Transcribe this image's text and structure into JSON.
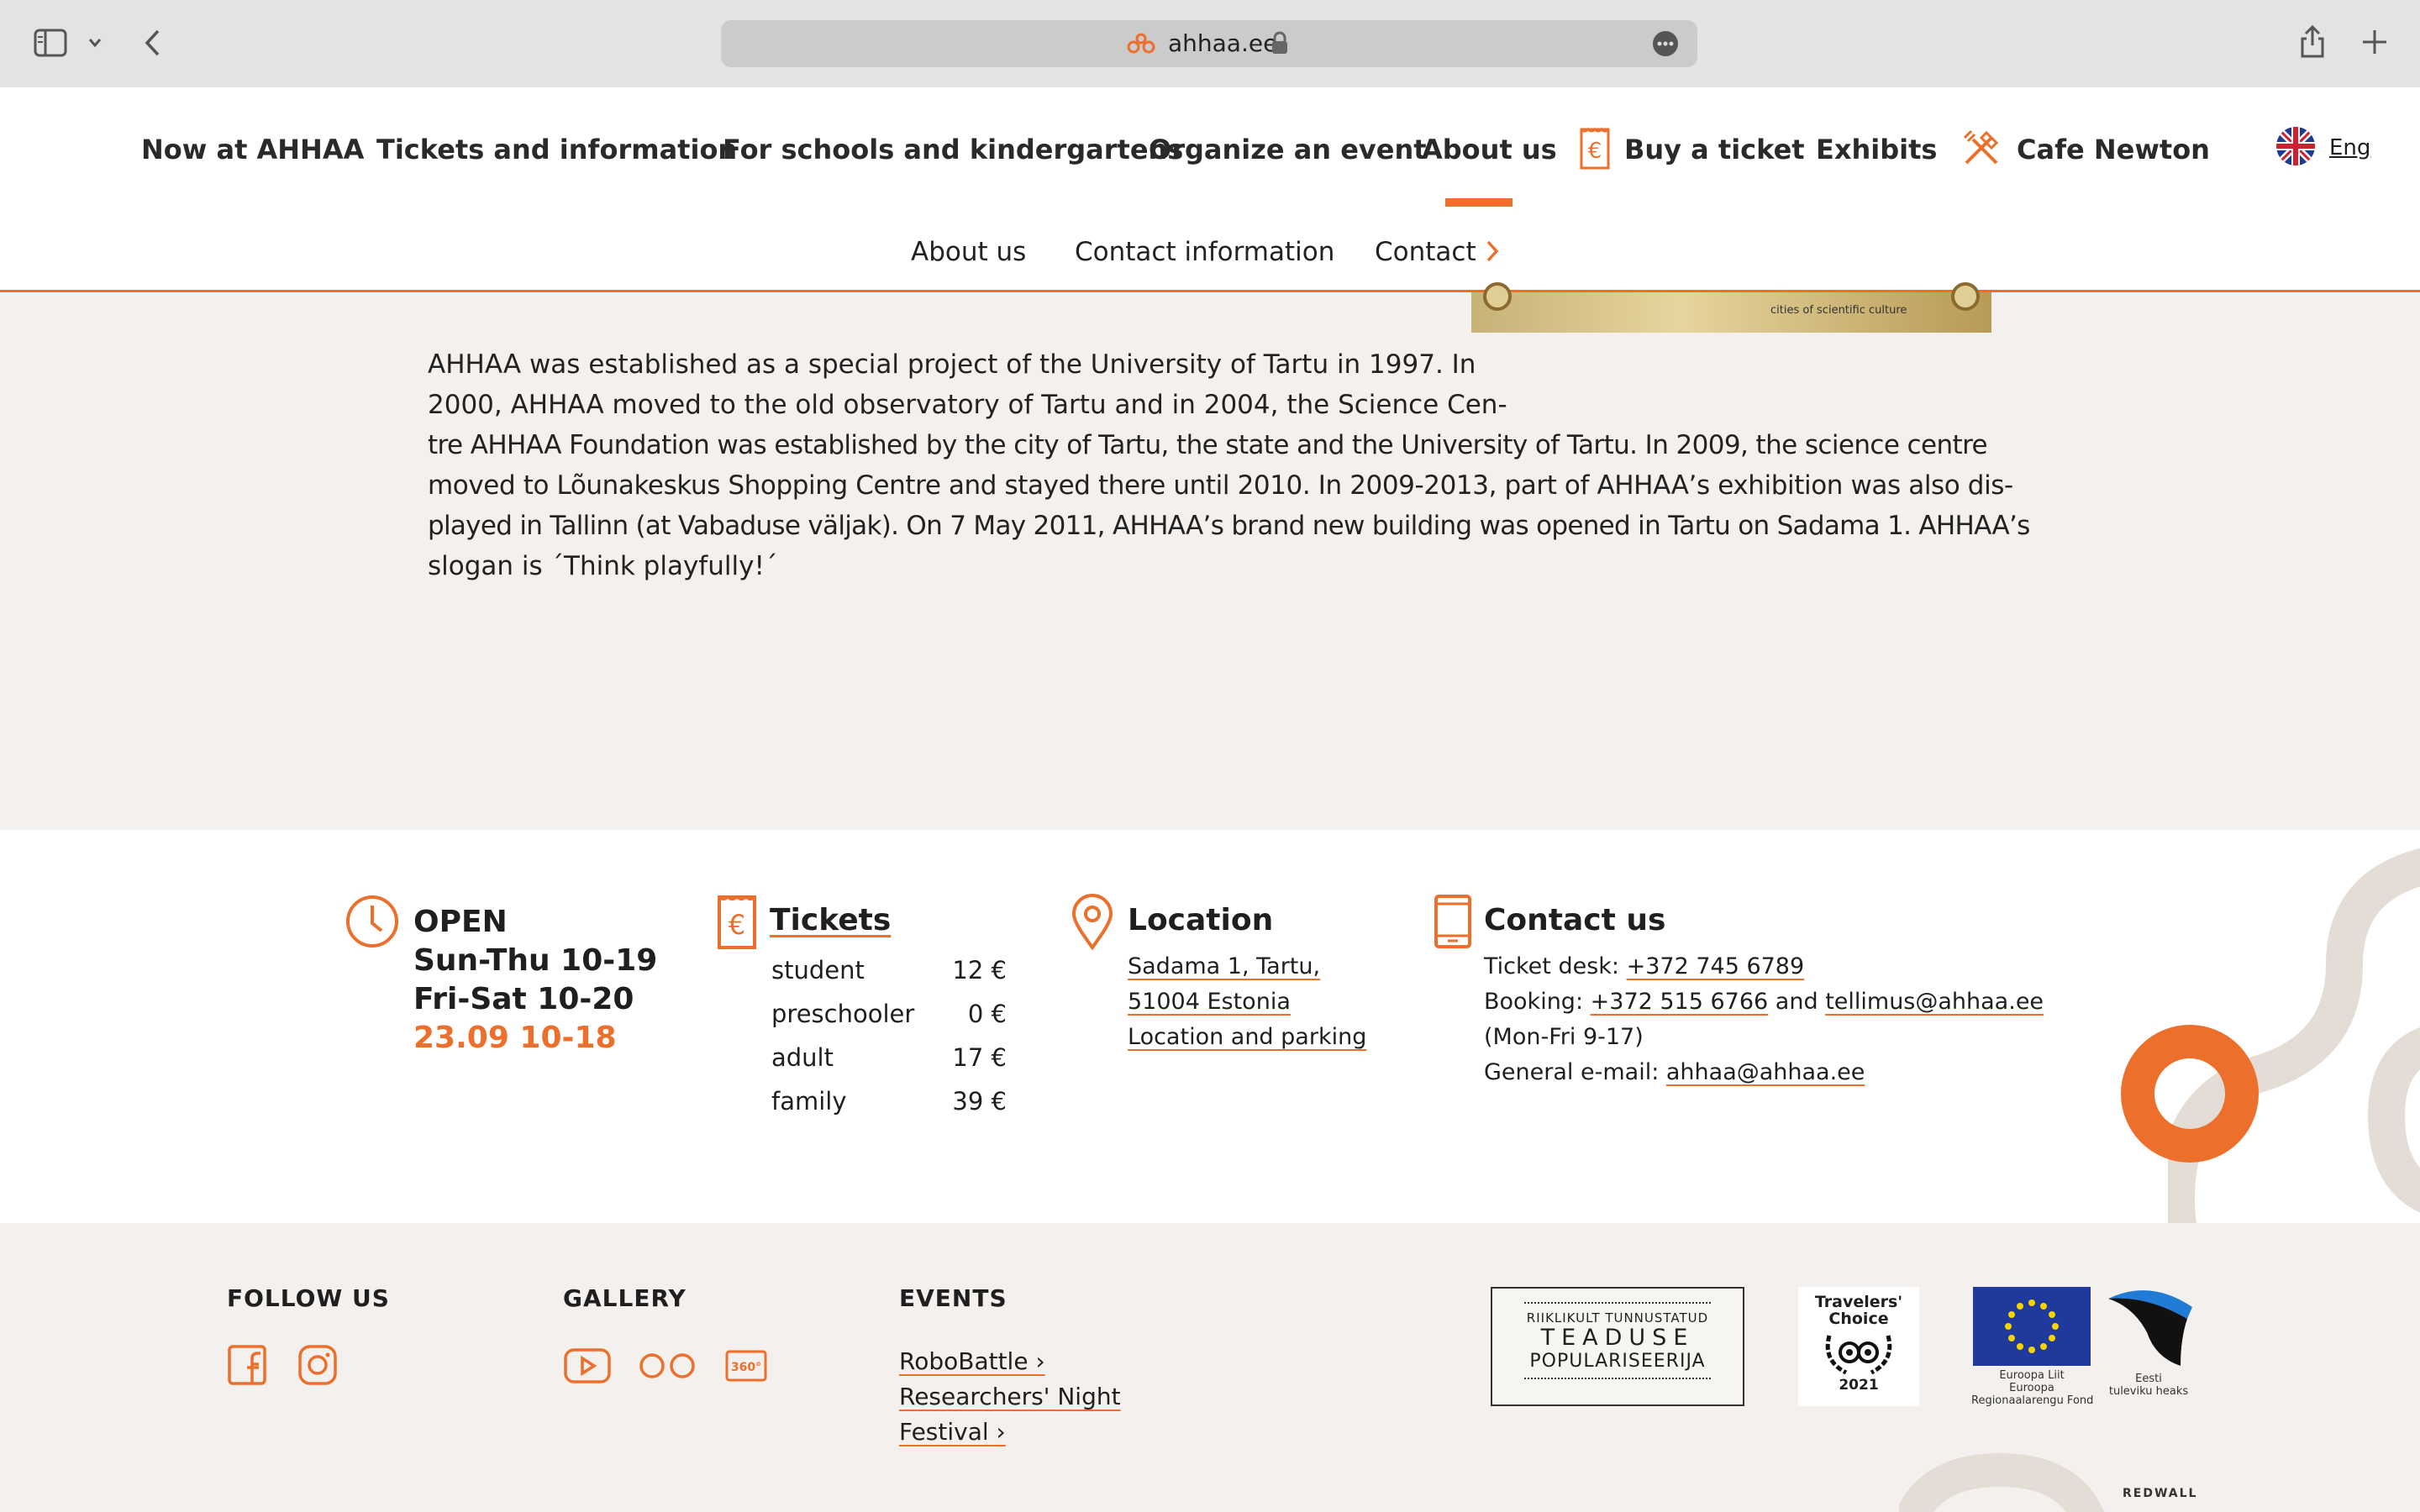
{
  "browser": {
    "url": "ahhaa.ee"
  },
  "nav": {
    "items": [
      "Now at AHHAA",
      "Tickets and information",
      "For schools and kindergartens",
      "Organize an event",
      "About us",
      "Buy a ticket",
      "Exhibits",
      "Cafe Newton"
    ],
    "lang": "Eng"
  },
  "subnav": [
    "About us",
    "Contact information",
    "Contact"
  ],
  "content": {
    "paragraph_lines": [
      "AHHAA was established as a special project of the University of Tartu in 1997. In",
      "2000, AHHAA moved to the old observatory of Tartu and in 2004, the Science Cen-",
      "tre AHHAA Foundation was established by the city of Tartu, the state and the University of Tartu. In 2009, the science centre",
      "moved to Lõunakeskus Shopping Centre and stayed there until 2010. In 2009-2013, part of AHHAA’s exhibition was also dis-",
      "played in Tallinn (at Vabaduse väljak). On 7 May 2011, AHHAA’s brand new building was opened in Tartu on Sadama 1. AHHAA’s",
      "slogan is ´Think playfully!´"
    ],
    "banner_text": "cities of scientific culture"
  },
  "open": {
    "title": "OPEN",
    "line1": "Sun-Thu 10-19",
    "line2": "Fri-Sat 10-20",
    "special": "23.09 10-18"
  },
  "tickets": {
    "title": "Tickets",
    "rows": [
      {
        "label": "student",
        "price": "12 €"
      },
      {
        "label": "preschooler",
        "price": "0 €"
      },
      {
        "label": "adult",
        "price": "17 €"
      },
      {
        "label": "family",
        "price": "39 €"
      }
    ]
  },
  "location": {
    "title": "Location",
    "line1": "Sadama 1, Tartu,",
    "line2": "51004 Estonia",
    "link": "Location and parking"
  },
  "contact": {
    "title": "Contact us",
    "desk_label": "Ticket desk: ",
    "desk_phone": "+372 745 6789",
    "booking_label": "Booking: ",
    "booking_phone": "+372 515 6766",
    "and": " and ",
    "booking_email": "tellimus@ahhaa.ee",
    "hours": "(Mon-Fri 9-17)",
    "general_label": "General e-mail: ",
    "general_email": "ahhaa@ahhaa.ee"
  },
  "footer": {
    "follow": "FOLLOW US",
    "gallery": "GALLERY",
    "events": "EVENTS",
    "event_links": [
      "RoboBattle ›",
      "Researchers' Night",
      "Festival ›"
    ],
    "badge1_line1": "RIIKLIKULT TUNNUSTATUD",
    "badge1_line2": "TEADUSE",
    "badge1_line3": "POPULARISEERIJA",
    "tc_line1": "Travelers'",
    "tc_line2": "Choice",
    "tc_year": "2021",
    "eu_line1": "Euroopa Liit",
    "eu_line2": "Euroopa",
    "eu_line3": "Regionaalarengu Fond",
    "ee_line1": "Eesti",
    "ee_line2": "tuleviku heaks",
    "credit": "REDWALL"
  },
  "colors": {
    "accent": "#ec6f2c",
    "bg": "#f3f0ed",
    "deco": "#e4ddd6"
  }
}
